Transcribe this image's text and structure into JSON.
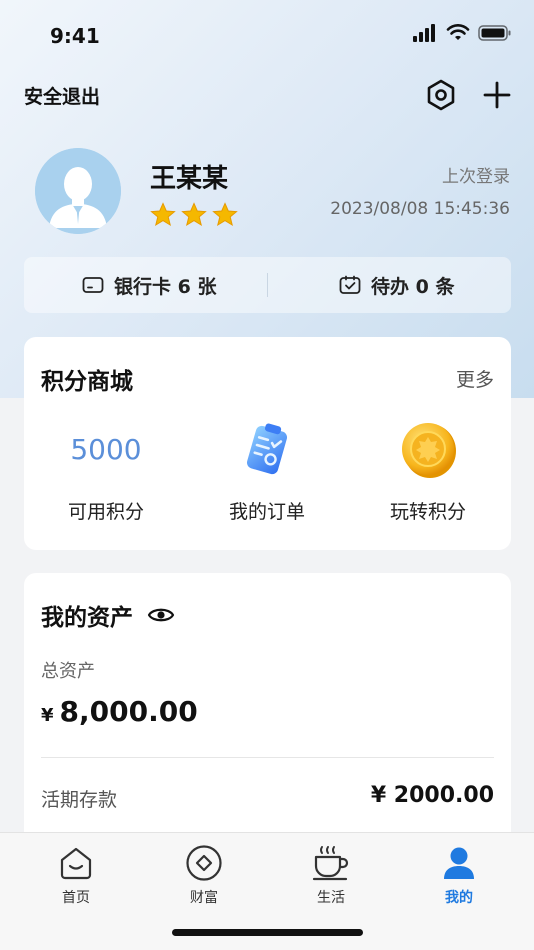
{
  "status_bar": {
    "time": "9:41"
  },
  "header": {
    "logout_label": "安全退出"
  },
  "profile": {
    "name": "王某某",
    "star_count": 3,
    "last_login_label": "上次登录",
    "last_login_time": "2023/08/08 15:45:36"
  },
  "quick": {
    "bank_card_label": "银行卡 6 张",
    "todo_label": "待办 0 条"
  },
  "points_mall": {
    "title": "积分商城",
    "more_label": "更多",
    "available_points_value": "5000",
    "available_points_label": "可用积分",
    "orders_label": "我的订单",
    "play_points_label": "玩转积分"
  },
  "assets": {
    "title": "我的资产",
    "total_label": "总资产",
    "currency_symbol": "¥",
    "total_value": "8,000.00",
    "deposit_label": "活期存款",
    "deposit_value": "¥ 2000.00"
  },
  "tabbar": {
    "tabs": [
      {
        "label": "首页",
        "icon": "home-icon"
      },
      {
        "label": "财富",
        "icon": "wealth-icon"
      },
      {
        "label": "生活",
        "icon": "coffee-cup-icon"
      },
      {
        "label": "我的",
        "icon": "user-icon",
        "active": true
      }
    ]
  },
  "colors": {
    "accent": "#1f7ae0",
    "points_value": "#5b8fd9",
    "star": "#f5b800"
  }
}
